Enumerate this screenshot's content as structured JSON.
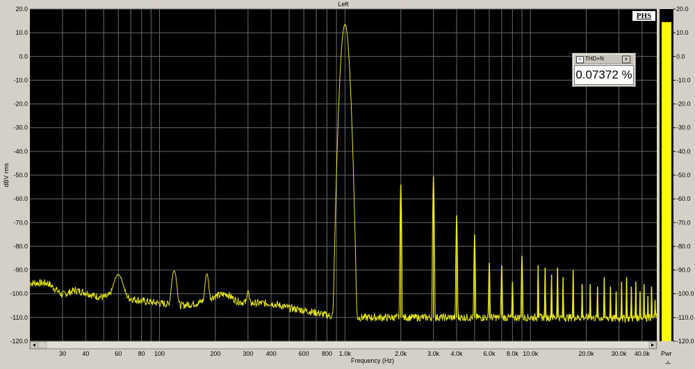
{
  "window": {
    "channel_title": "Left",
    "ylabel": "dBV rms",
    "xlabel": "Frequency (Hz)",
    "pwr_label": "Pwr",
    "phs_label": "PHS"
  },
  "thd_widget": {
    "title": "THD+N",
    "icon": "meter-icon",
    "close_glyph": "×",
    "value": "0.07372 %"
  },
  "colors": {
    "trace": "#e8e81a",
    "plot_bg": "#000000",
    "grid": "#6a6a6a",
    "meter": "#ffff00"
  },
  "chart_data": {
    "type": "line",
    "x_scale": "log",
    "xlim": [
      20,
      48000
    ],
    "ylim": [
      -120,
      20
    ],
    "grid": true,
    "y_ticks": [
      20,
      10,
      0,
      -10,
      -20,
      -30,
      -40,
      -50,
      -60,
      -70,
      -80,
      -90,
      -100,
      -110,
      -120
    ],
    "y_tick_labels": [
      "20.0",
      "10.0",
      "0.0",
      "-10.0",
      "-20.0",
      "-30.0",
      "-40.0",
      "-50.0",
      "-60.0",
      "-70.0",
      "-80.0",
      "-90.0",
      "-100.0",
      "-110.0",
      "-120.0"
    ],
    "x_ticks": [
      30,
      40,
      60,
      80,
      100,
      200,
      300,
      400,
      600,
      800,
      1000,
      2000,
      3000,
      4000,
      6000,
      8000,
      10000,
      20000,
      30000,
      40000
    ],
    "x_tick_labels": [
      "30",
      "40",
      "60",
      "80",
      "100",
      "200",
      "300",
      "400",
      "600",
      "800",
      "1.0k",
      "2.0k",
      "3.0k",
      "4.0k",
      "6.0k",
      "8.0k",
      "10.0k",
      "20.0k",
      "30.0k",
      "40.0k"
    ],
    "x_minor_grid": [
      50,
      70,
      90,
      500,
      700,
      900,
      5000,
      7000,
      9000
    ],
    "noise_floor": [
      [
        20,
        -95.5
      ],
      [
        25,
        -95.5
      ],
      [
        30,
        -100.5
      ],
      [
        35,
        -98.5
      ],
      [
        40,
        -99.5
      ],
      [
        45,
        -101
      ],
      [
        50,
        -101.5
      ],
      [
        55,
        -101
      ],
      [
        60,
        -101
      ],
      [
        70,
        -102
      ],
      [
        80,
        -103
      ],
      [
        100,
        -104
      ],
      [
        130,
        -105
      ],
      [
        160,
        -104
      ],
      [
        200,
        -101
      ],
      [
        230,
        -100
      ],
      [
        260,
        -103
      ],
      [
        300,
        -104
      ],
      [
        350,
        -104
      ],
      [
        400,
        -104
      ],
      [
        500,
        -106
      ],
      [
        600,
        -107
      ],
      [
        700,
        -108
      ],
      [
        800,
        -109
      ],
      [
        900,
        -110
      ],
      [
        1200,
        -110
      ],
      [
        1500,
        -110
      ],
      [
        2000,
        -110
      ],
      [
        3000,
        -110
      ],
      [
        5000,
        -110
      ],
      [
        10000,
        -110
      ],
      [
        20000,
        -110
      ],
      [
        30000,
        -110.5
      ],
      [
        48000,
        -110
      ]
    ],
    "peaks": [
      {
        "f": 60,
        "db": -92.5,
        "w": 0.04
      },
      {
        "f": 120,
        "db": -90.5,
        "w": 0.02
      },
      {
        "f": 180,
        "db": -92,
        "w": 0.015
      },
      {
        "f": 300,
        "db": -100,
        "w": 0.01
      },
      {
        "f": 1000,
        "db": 13.5,
        "w": 0.02
      },
      {
        "f": 2000,
        "db": -54,
        "w": 0.004
      },
      {
        "f": 3000,
        "db": -50.5,
        "w": 0.004
      },
      {
        "f": 4000,
        "db": -67,
        "w": 0.004
      },
      {
        "f": 5000,
        "db": -75,
        "w": 0.004
      },
      {
        "f": 6000,
        "db": -87,
        "w": 0.004
      },
      {
        "f": 7000,
        "db": -88,
        "w": 0.004
      },
      {
        "f": 8000,
        "db": -95,
        "w": 0.004
      },
      {
        "f": 9000,
        "db": -84,
        "w": 0.004
      },
      {
        "f": 11000,
        "db": -88,
        "w": 0.003
      },
      {
        "f": 12000,
        "db": -89,
        "w": 0.003
      },
      {
        "f": 13000,
        "db": -92,
        "w": 0.003
      },
      {
        "f": 14000,
        "db": -89,
        "w": 0.003
      },
      {
        "f": 15000,
        "db": -93,
        "w": 0.003
      },
      {
        "f": 17000,
        "db": -90,
        "w": 0.003
      },
      {
        "f": 19000,
        "db": -96,
        "w": 0.003
      },
      {
        "f": 21000,
        "db": -96,
        "w": 0.003
      },
      {
        "f": 23000,
        "db": -97,
        "w": 0.003
      },
      {
        "f": 25000,
        "db": -93,
        "w": 0.003
      },
      {
        "f": 27000,
        "db": -97,
        "w": 0.003
      },
      {
        "f": 29000,
        "db": -99,
        "w": 0.003
      },
      {
        "f": 31000,
        "db": -95,
        "w": 0.003
      },
      {
        "f": 33000,
        "db": -93,
        "w": 0.003
      },
      {
        "f": 35000,
        "db": -97,
        "w": 0.003
      },
      {
        "f": 37000,
        "db": -95,
        "w": 0.003
      },
      {
        "f": 39000,
        "db": -99,
        "w": 0.003
      },
      {
        "f": 41000,
        "db": -96,
        "w": 0.003
      },
      {
        "f": 43000,
        "db": -101,
        "w": 0.003
      },
      {
        "f": 45000,
        "db": -97,
        "w": 0.003
      },
      {
        "f": 47000,
        "db": -103,
        "w": 0.003
      }
    ],
    "meter": {
      "level": 14.5,
      "ylim": [
        -120,
        20
      ],
      "y_tick_labels": [
        "20.0",
        "10.0",
        "0.0",
        "-10.0",
        "-20.0",
        "-30.0",
        "-40.0",
        "-50.0",
        "-60.0",
        "-70.0",
        "-80.0",
        "-90.0",
        "-100.0",
        "-110.0",
        "-120.0"
      ]
    }
  }
}
